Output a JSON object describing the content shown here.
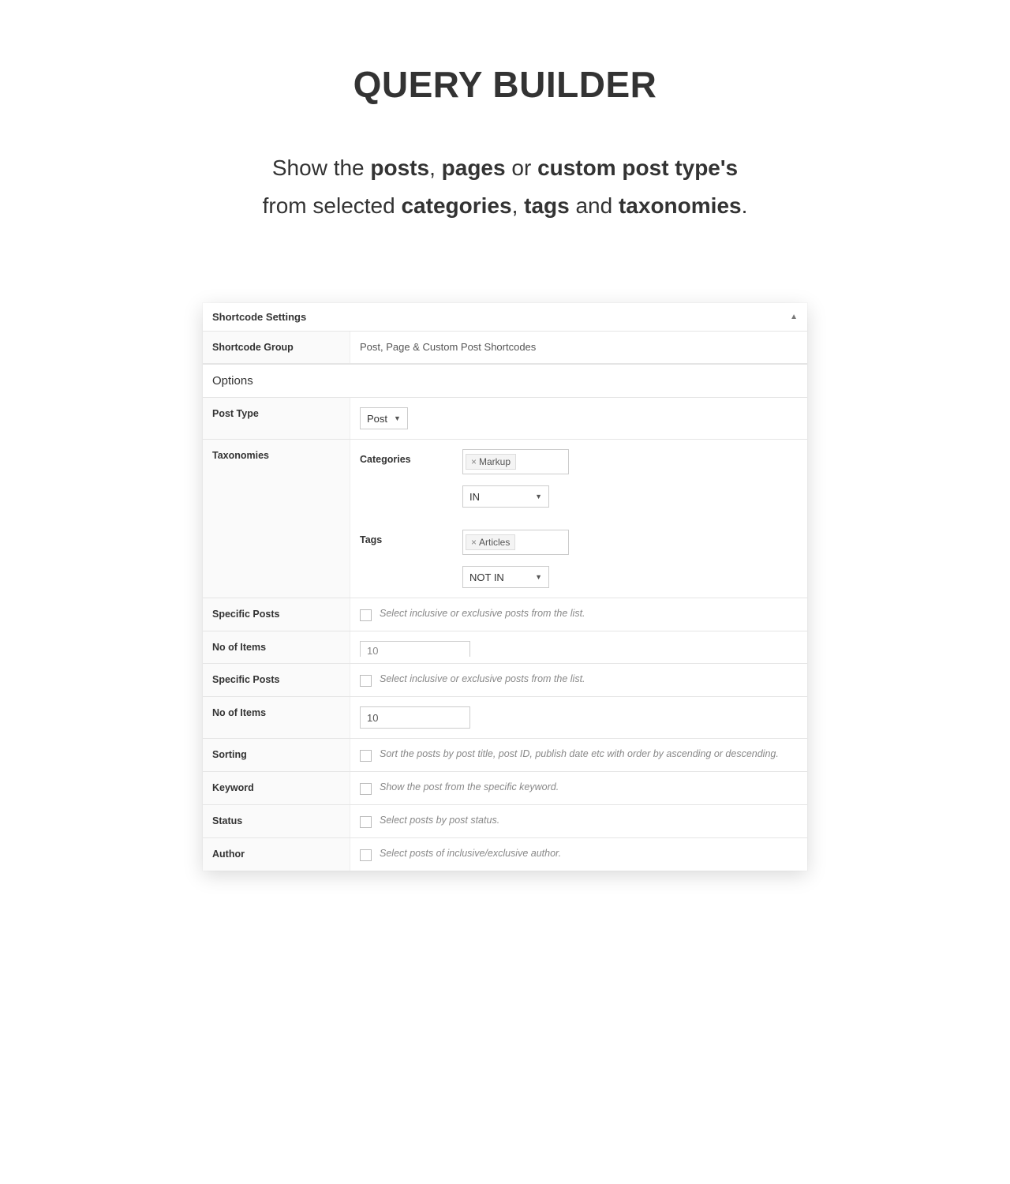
{
  "hero": {
    "title": "QUERY BUILDER",
    "sub_line1_parts": [
      "Show the ",
      "posts",
      ", ",
      "pages",
      " or ",
      "custom post type's"
    ],
    "sub_line2_parts": [
      "from selected ",
      "categories",
      ", ",
      "tags",
      " and ",
      "taxonomies",
      "."
    ]
  },
  "panel": {
    "header": "Shortcode Settings",
    "shortcode_group_label": "Shortcode Group",
    "shortcode_group_value": "Post, Page & Custom Post Shortcodes",
    "options_label": "Options",
    "post_type_label": "Post Type",
    "post_type_value": "Post",
    "taxonomies_label": "Taxonomies",
    "categories_label": "Categories",
    "categories_tag": "Markup",
    "categories_op": "IN",
    "tags_label": "Tags",
    "tags_tag": "Articles",
    "tags_op": "NOT IN",
    "specific_posts_label": "Specific Posts",
    "specific_posts_desc": "Select inclusive or exclusive posts from the list.",
    "no_items_label": "No of Items",
    "no_items_value": "10",
    "sorting_label": "Sorting",
    "sorting_desc": "Sort the posts by post title, post ID, publish date etc with order by ascending or descending.",
    "keyword_label": "Keyword",
    "keyword_desc": "Show the post from the specific keyword.",
    "status_label": "Status",
    "status_desc": "Select posts by post status.",
    "author_label": "Author",
    "author_desc": "Select posts of inclusive/exclusive author."
  }
}
